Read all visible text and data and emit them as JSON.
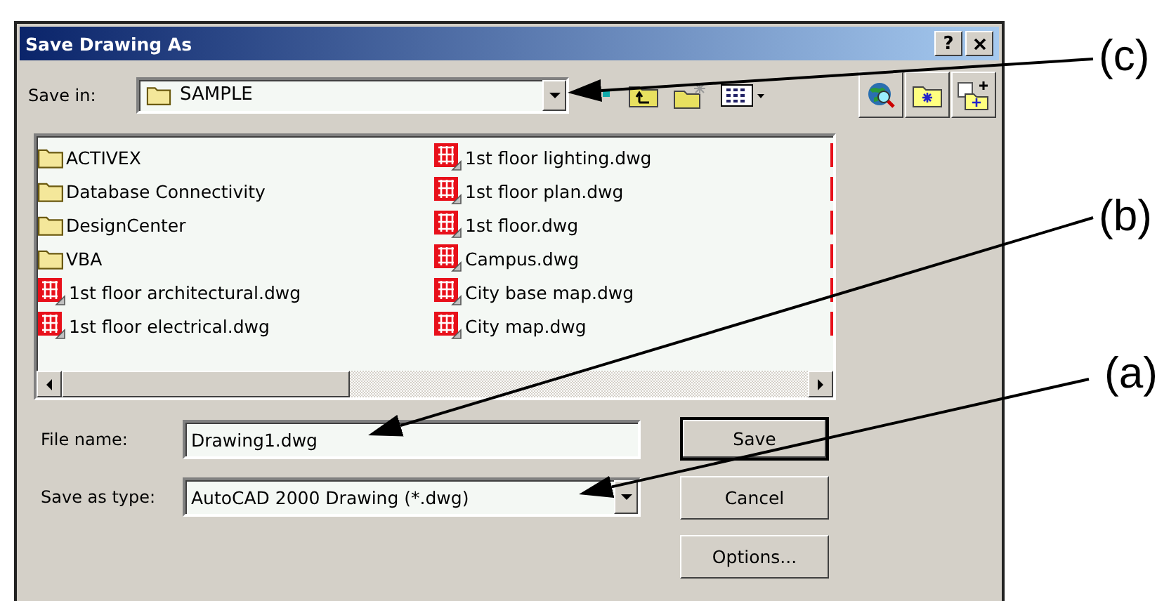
{
  "window": {
    "title": "Save Drawing As",
    "help": "?"
  },
  "save_in": {
    "label": "Save in:",
    "value": "SAMPLE"
  },
  "files": [
    {
      "name": "ACTIVEX",
      "kind": "folder"
    },
    {
      "name": "Database Connectivity",
      "kind": "folder"
    },
    {
      "name": "DesignCenter",
      "kind": "folder"
    },
    {
      "name": "VBA",
      "kind": "folder"
    },
    {
      "name": "1st floor architectural.dwg",
      "kind": "drawing"
    },
    {
      "name": "1st floor electrical.dwg",
      "kind": "drawing"
    },
    {
      "name": "1st floor lighting.dwg",
      "kind": "drawing"
    },
    {
      "name": "1st floor plan.dwg",
      "kind": "drawing"
    },
    {
      "name": "1st floor.dwg",
      "kind": "drawing"
    },
    {
      "name": "Campus.dwg",
      "kind": "drawing"
    },
    {
      "name": "City base map.dwg",
      "kind": "drawing"
    },
    {
      "name": "City map.dwg",
      "kind": "drawing"
    }
  ],
  "file_name": {
    "label": "File name:",
    "value": "Drawing1.dwg"
  },
  "save_as_type": {
    "label": "Save as type:",
    "value": "AutoCAD 2000 Drawing (*.dwg)"
  },
  "buttons": [
    {
      "label": "Save",
      "default": true
    },
    {
      "label": "Cancel",
      "default": false
    },
    {
      "label": "Options...",
      "default": false
    }
  ],
  "callouts": [
    {
      "label": "(c)"
    },
    {
      "label": "(b)"
    },
    {
      "label": "(a)"
    }
  ]
}
